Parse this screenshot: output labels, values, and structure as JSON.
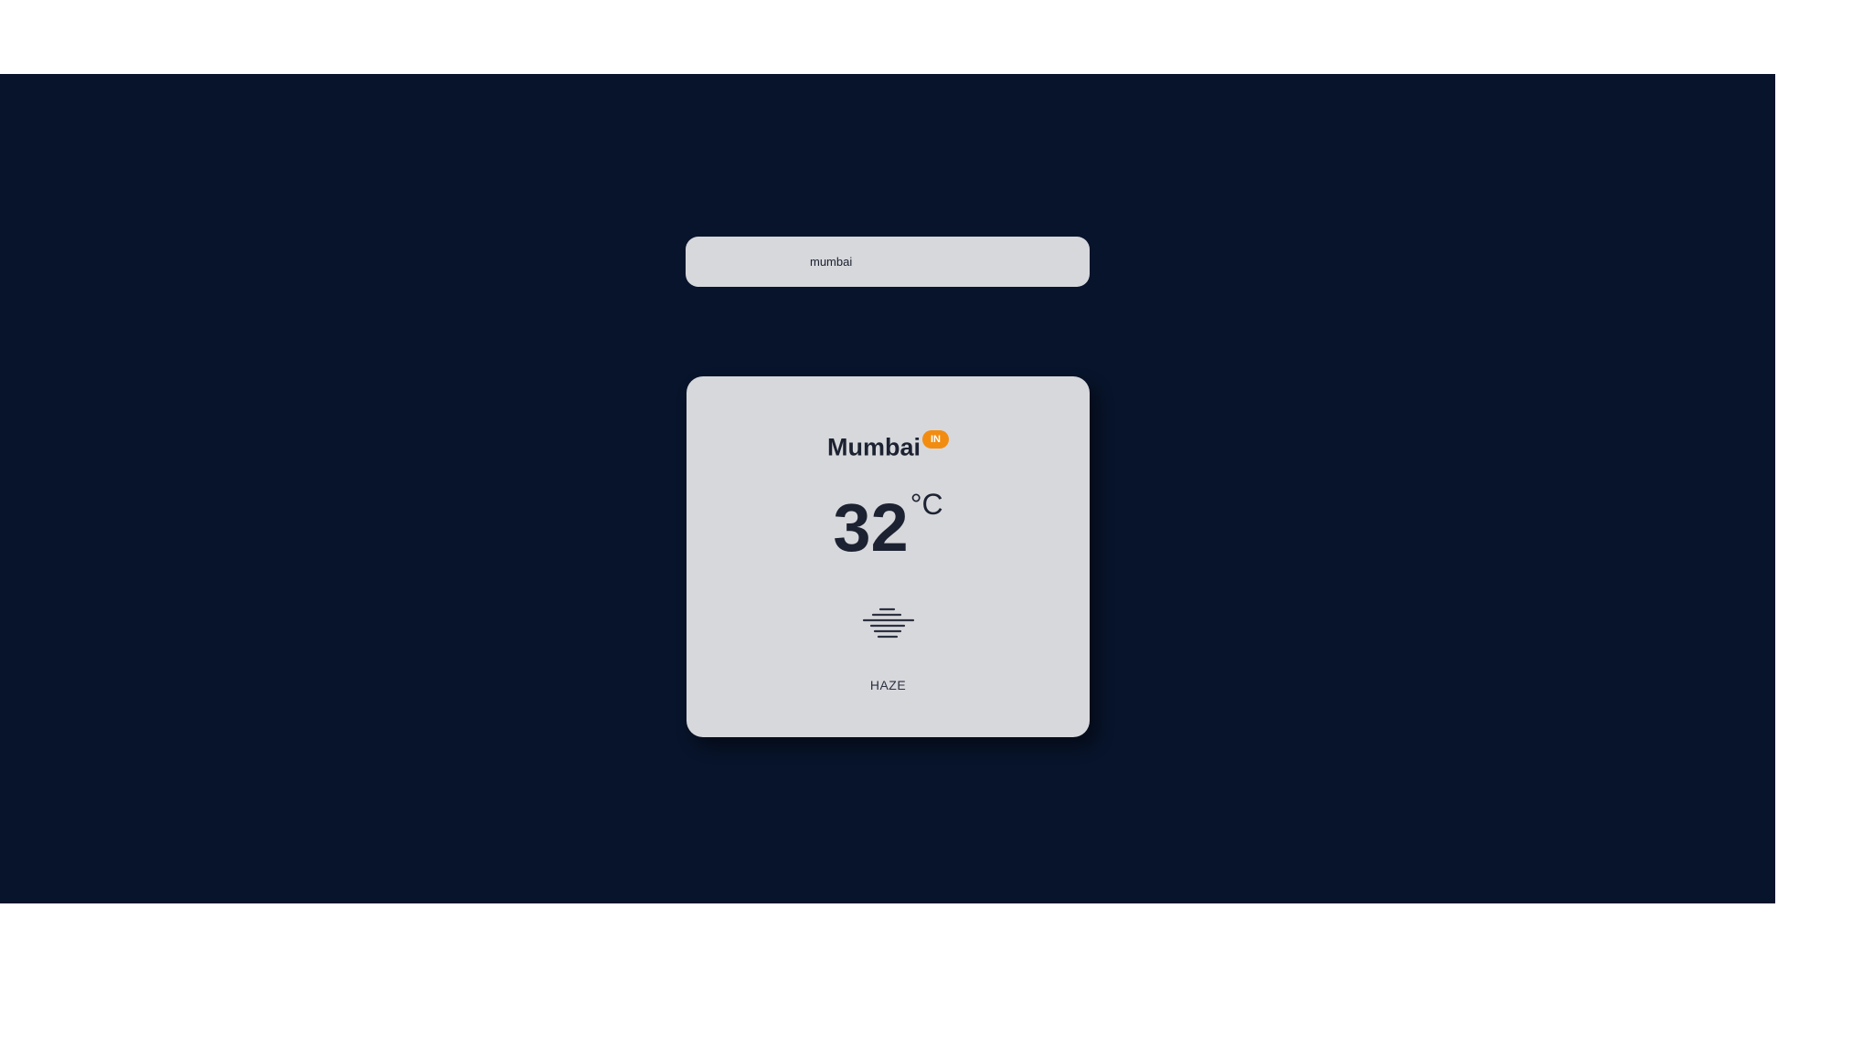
{
  "search": {
    "value": "mumbai",
    "placeholder": ""
  },
  "weather": {
    "city": "Mumbai",
    "country": "IN",
    "temperature": "32",
    "unit": "°C",
    "condition": "HAZE",
    "icon": "haze-icon"
  },
  "colors": {
    "background": "#08142b",
    "card": "#d7d8dc",
    "badge": "#f28c10",
    "text": "#1c2231"
  }
}
